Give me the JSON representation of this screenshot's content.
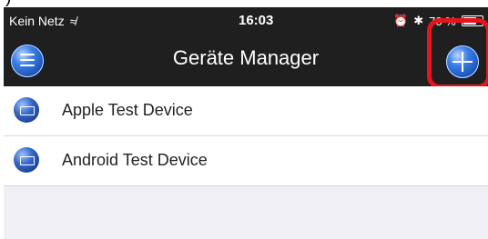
{
  "status_bar": {
    "carrier": "Kein Netz",
    "time": "16:03",
    "battery": "70 %"
  },
  "navbar": {
    "title": "Geräte Manager"
  },
  "devices": [
    {
      "label": "Apple Test Device"
    },
    {
      "label": "Android Test Device"
    }
  ],
  "colors": {
    "navbar_bg": "#1f1f1f",
    "highlight": "#e8141b",
    "list_bg": "#ffffff",
    "empty_bg": "#efeff4"
  }
}
